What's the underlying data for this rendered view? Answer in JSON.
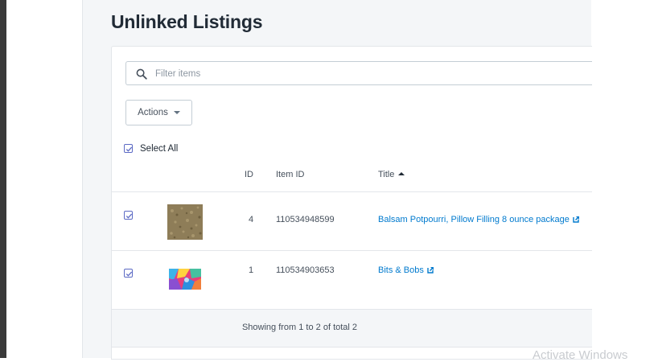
{
  "page": {
    "title": "Unlinked Listings"
  },
  "filter": {
    "placeholder": "Filter items",
    "value": ""
  },
  "toolbar": {
    "actions_label": "Actions",
    "select_all_label": "Select All",
    "select_all_checked": true
  },
  "table": {
    "headers": {
      "id": "ID",
      "item_id": "Item ID",
      "title": "Title"
    },
    "sort": {
      "column": "title",
      "direction": "ascending"
    },
    "rows": [
      {
        "checked": true,
        "id": "4",
        "item_id": "110534948599",
        "title": "Balsam Potpourri, Pillow Filling 8 ounce package",
        "thumbnail": "potpourri-thumbnail"
      },
      {
        "checked": true,
        "id": "1",
        "item_id": "110534903653",
        "title": "Bits & Bobs",
        "thumbnail": "fabric-thumbnail"
      }
    ]
  },
  "footer": {
    "summary": "Showing from 1 to 2 of total 2"
  },
  "watermark": {
    "text": "Activate Windows"
  },
  "colors": {
    "accent": "#5c6ac4",
    "link": "#007ace",
    "background": "#f4f6f8"
  }
}
